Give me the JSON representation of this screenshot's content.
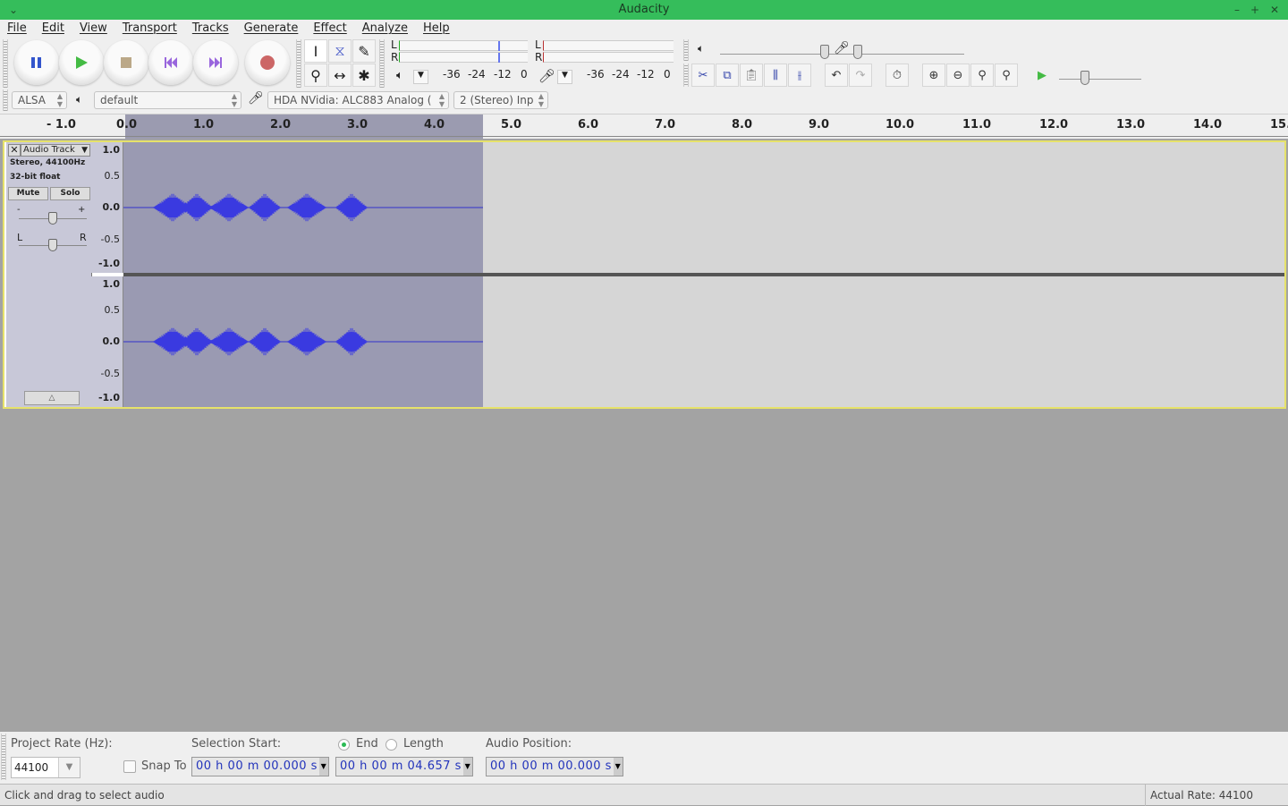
{
  "window": {
    "title": "Audacity"
  },
  "menu": [
    "File",
    "Edit",
    "View",
    "Transport",
    "Tracks",
    "Generate",
    "Effect",
    "Analyze",
    "Help"
  ],
  "transport": {
    "buttons": [
      {
        "name": "pause",
        "color": "#3355cc"
      },
      {
        "name": "play",
        "color": "#44bb44"
      },
      {
        "name": "stop",
        "color": "#bba888"
      },
      {
        "name": "skip-start",
        "color": "#9966dd"
      },
      {
        "name": "skip-end",
        "color": "#9966dd"
      },
      {
        "name": "record",
        "color": "#cc6666"
      }
    ]
  },
  "meters": {
    "playback": {
      "L": "L",
      "R": "R",
      "ticks": [
        "-36",
        "-24",
        "-12",
        "0"
      ]
    },
    "record": {
      "L": "L",
      "R": "R",
      "ticks": [
        "-36",
        "-24",
        "-12",
        "0"
      ]
    }
  },
  "devices": {
    "host": "ALSA",
    "output": "default",
    "input": "HDA NVidia: ALC883 Analog (",
    "channels": "2 (Stereo) Inp"
  },
  "ruler": {
    "labels": [
      "- 1.0",
      "0.0",
      "1.0",
      "2.0",
      "3.0",
      "4.0",
      "5.0",
      "6.0",
      "7.0",
      "8.0",
      "9.0",
      "10.0",
      "11.0",
      "12.0",
      "13.0",
      "14.0",
      "15.0"
    ]
  },
  "track": {
    "name": "Audio Track",
    "info1": "Stereo, 44100Hz",
    "info2": "32-bit float",
    "mute": "Mute",
    "solo": "Solo",
    "gain_minus": "-",
    "gain_plus": "+",
    "pan_left": "L",
    "pan_right": "R",
    "gain": 0.5,
    "pan": 0.5,
    "scale": [
      "1.0",
      "0.5",
      "0.0",
      "-0.5",
      "-1.0"
    ],
    "selection_seconds": [
      0,
      4.657
    ]
  },
  "selection": {
    "project_rate_label": "Project Rate (Hz):",
    "project_rate": "44100",
    "snap_to": "Snap To",
    "snap_checked": false,
    "start_label": "Selection Start:",
    "end_label": "End",
    "length_label": "Length",
    "end_selected": true,
    "audio_position_label": "Audio Position:",
    "start": "00 h 00 m 00.000 s",
    "end": "00 h 00 m 04.657 s",
    "position": "00 h 00 m 00.000 s"
  },
  "status": {
    "message": "Click and drag to select audio",
    "rate": "Actual Rate: 44100"
  }
}
